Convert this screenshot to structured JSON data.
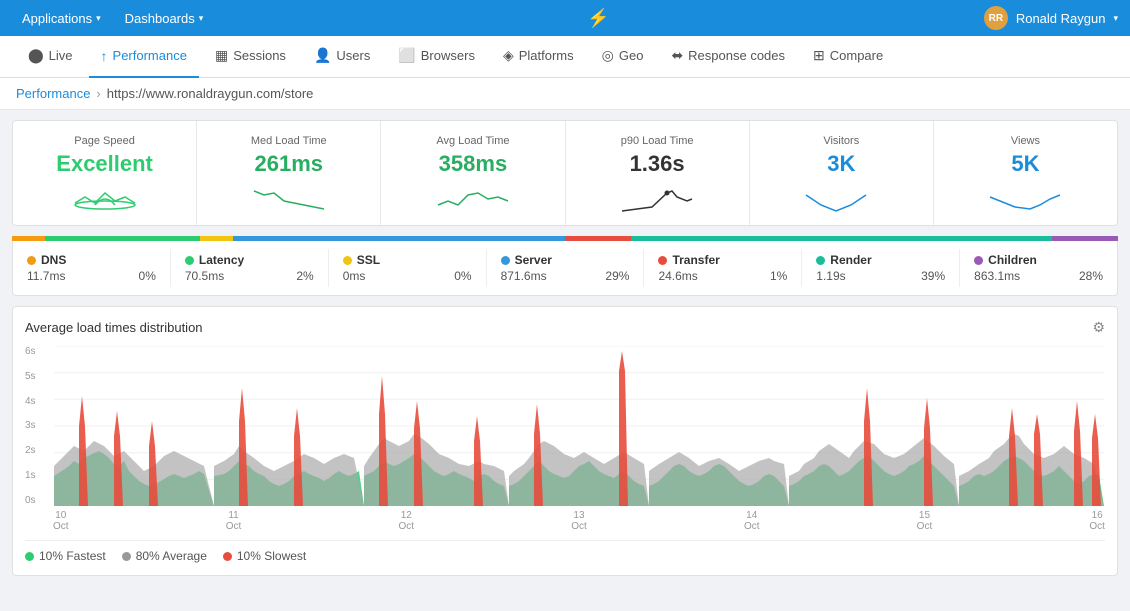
{
  "topnav": {
    "app_label": "Applications",
    "dash_label": "Dashboards",
    "user_name": "Ronald Raygun"
  },
  "tabs": [
    {
      "id": "live",
      "label": "Live",
      "icon": "⬤",
      "active": false
    },
    {
      "id": "performance",
      "label": "Performance",
      "icon": "↑",
      "active": true
    },
    {
      "id": "sessions",
      "label": "Sessions",
      "icon": "▦",
      "active": false
    },
    {
      "id": "users",
      "label": "Users",
      "icon": "👤",
      "active": false
    },
    {
      "id": "browsers",
      "label": "Browsers",
      "icon": "⬜",
      "active": false
    },
    {
      "id": "platforms",
      "label": "Platforms",
      "icon": "◈",
      "active": false
    },
    {
      "id": "geo",
      "label": "Geo",
      "icon": "◎",
      "active": false
    },
    {
      "id": "response-codes",
      "label": "Response codes",
      "icon": "⬌",
      "active": false
    },
    {
      "id": "compare",
      "label": "Compare",
      "icon": "⊞",
      "active": false
    }
  ],
  "breadcrumb": {
    "link_label": "Performance",
    "separator": "›",
    "current": "https://www.ronaldraygun.com/store"
  },
  "metrics": [
    {
      "label": "Page Speed",
      "value": "Excellent",
      "value_class": "green",
      "sparkline_type": "heart"
    },
    {
      "label": "Med Load Time",
      "value": "261ms",
      "value_class": "green-med",
      "sparkline_type": "line_down"
    },
    {
      "label": "Avg Load Time",
      "value": "358ms",
      "value_class": "green-med",
      "sparkline_type": "line_wave"
    },
    {
      "label": "p90 Load Time",
      "value": "1.36s",
      "value_class": "dark",
      "sparkline_type": "line_spike"
    },
    {
      "label": "Visitors",
      "value": "3K",
      "value_class": "blue",
      "sparkline_type": "line_u"
    },
    {
      "label": "Views",
      "value": "5K",
      "value_class": "blue",
      "sparkline_type": "line_u2"
    }
  ],
  "color_bar": [
    {
      "color": "#f39c12",
      "width": "3%"
    },
    {
      "color": "#2ecc71",
      "width": "14%"
    },
    {
      "color": "#f1c40f",
      "width": "3%"
    },
    {
      "color": "#3498db",
      "width": "30%"
    },
    {
      "color": "#e74c3c",
      "width": "6%"
    },
    {
      "color": "#1abc9c",
      "width": "38%"
    },
    {
      "color": "#9b59b6",
      "width": "6%"
    }
  ],
  "timing": [
    {
      "label": "DNS",
      "color": "#f39c12",
      "value": "11.7ms",
      "pct": "0%"
    },
    {
      "label": "Latency",
      "color": "#2ecc71",
      "value": "70.5ms",
      "pct": "2%"
    },
    {
      "label": "SSL",
      "color": "#f1c40f",
      "value": "0ms",
      "pct": "0%"
    },
    {
      "label": "Server",
      "color": "#3498db",
      "value": "871.6ms",
      "pct": "29%"
    },
    {
      "label": "Transfer",
      "color": "#e74c3c",
      "value": "24.6ms",
      "pct": "1%"
    },
    {
      "label": "Render",
      "color": "#1abc9c",
      "value": "1.19s",
      "pct": "39%"
    },
    {
      "label": "Children",
      "color": "#9b59b6",
      "value": "863.1ms",
      "pct": "28%"
    }
  ],
  "chart": {
    "title": "Average load times distribution",
    "y_labels": [
      "6s",
      "5s",
      "4s",
      "3s",
      "2s",
      "1s",
      "0s"
    ],
    "x_labels": [
      {
        "label": "10",
        "sub": "Oct"
      },
      {
        "label": "11",
        "sub": "Oct"
      },
      {
        "label": "12",
        "sub": "Oct"
      },
      {
        "label": "13",
        "sub": "Oct"
      },
      {
        "label": "14",
        "sub": "Oct"
      },
      {
        "label": "15",
        "sub": "Oct"
      },
      {
        "label": "16",
        "sub": "Oct"
      }
    ],
    "legend": [
      {
        "label": "10% Fastest",
        "color": "#2ecc71"
      },
      {
        "label": "80% Average",
        "color": "#999"
      },
      {
        "label": "10% Slowest",
        "color": "#e74c3c"
      }
    ]
  }
}
